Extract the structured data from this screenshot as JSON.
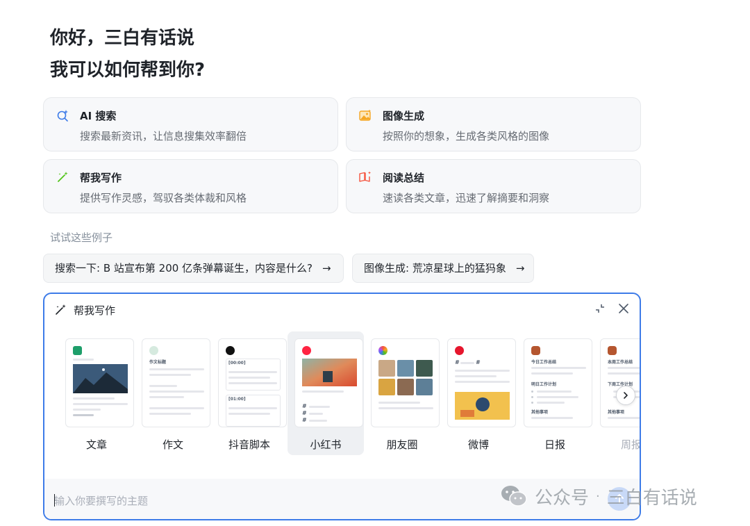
{
  "greeting": {
    "line1": "你好，三白有话说",
    "line2": "我可以如何帮到你?"
  },
  "features": [
    {
      "title": "AI 搜索",
      "desc": "搜索最新资讯，让信息搜集效率翻倍",
      "icon": "ai-search-icon",
      "color": "#3d7be8"
    },
    {
      "title": "图像生成",
      "desc": "按照你的想象，生成各类风格的图像",
      "icon": "image-icon",
      "color": "#f5a623"
    },
    {
      "title": "帮我写作",
      "desc": "提供写作灵感，驾驭各类体裁和风格",
      "icon": "magic-pen-icon",
      "color": "#52c41a"
    },
    {
      "title": "阅读总结",
      "desc": "速读各类文章，迅速了解摘要和洞察",
      "icon": "book-icon",
      "color": "#f5533d"
    }
  ],
  "examples": {
    "label": "试试这些例子",
    "items": [
      {
        "text": "搜索一下: B 站宣布第 200 亿条弹幕诞生，内容是什么?",
        "arrow": "→"
      },
      {
        "text": "图像生成: 荒凉星球上的猛犸象",
        "arrow": "→"
      }
    ]
  },
  "panel": {
    "title": "帮我写作",
    "templates": [
      {
        "name": "文章",
        "header": ""
      },
      {
        "name": "作文",
        "header": "作文标题"
      },
      {
        "name": "抖音脚本",
        "header": "[00:00]",
        "header2": "[01:00]"
      },
      {
        "name": "小红书",
        "header": "",
        "active": true
      },
      {
        "name": "朋友圈",
        "header": ""
      },
      {
        "name": "微博",
        "header": "#"
      },
      {
        "name": "日报",
        "header": "今日工作总结",
        "header2": "明日工作计划",
        "header3": "其他事项"
      },
      {
        "name": "周报",
        "header": "本周工作总结",
        "header2": "下周工作计划",
        "header3": "其他事项"
      }
    ],
    "input_placeholder": "输入你要撰写的主题"
  },
  "watermark": {
    "text": "公众号",
    "dot": "·",
    "author": "三白有话说"
  },
  "colors": {
    "accent": "#3d7be8",
    "card_bg": "#f7f8fa",
    "muted_text": "#86909c"
  }
}
